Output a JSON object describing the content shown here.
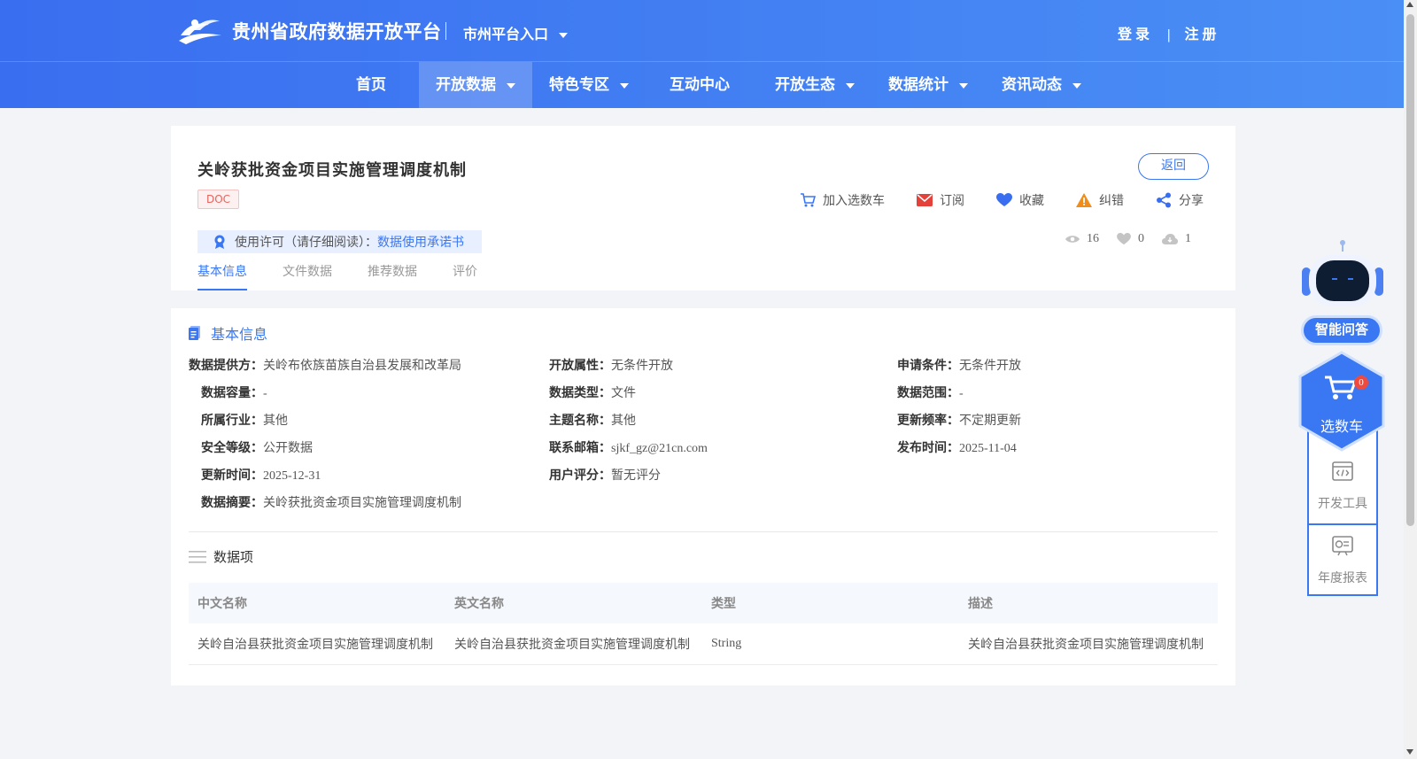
{
  "header": {
    "site_title": "贵州省政府数据开放平台",
    "city_entry": "市州平台入口",
    "login": "登录",
    "auth_sep": "|",
    "register": "注册"
  },
  "nav": {
    "items": [
      {
        "label": "首页",
        "has_dropdown": false,
        "active": false
      },
      {
        "label": "开放数据",
        "has_dropdown": true,
        "active": true
      },
      {
        "label": "特色专区",
        "has_dropdown": true,
        "active": false
      },
      {
        "label": "互动中心",
        "has_dropdown": false,
        "active": false
      },
      {
        "label": "开放生态",
        "has_dropdown": true,
        "active": false
      },
      {
        "label": "数据统计",
        "has_dropdown": true,
        "active": false
      },
      {
        "label": "资讯动态",
        "has_dropdown": true,
        "active": false
      }
    ]
  },
  "dataset": {
    "title": "关岭获批资金项目实施管理调度机制",
    "format_tag": "DOC",
    "back_label": "返回",
    "actions": {
      "cart": "加入选数车",
      "subscribe": "订阅",
      "favorite": "收藏",
      "report": "纠错",
      "share": "分享"
    },
    "license_label": "使用许可（请仔细阅读）：",
    "license_link": "数据使用承诺书",
    "stats": {
      "views": "16",
      "likes": "0",
      "downloads": "1"
    },
    "tabs": [
      "基本信息",
      "文件数据",
      "推荐数据",
      "评价"
    ]
  },
  "basic_info": {
    "section_title": "基本信息",
    "fields": {
      "provider": {
        "label": "数据提供方：",
        "value": "关岭布依族苗族自治县发展和改革局"
      },
      "open_attr": {
        "label": "开放属性：",
        "value": "无条件开放"
      },
      "apply_cond": {
        "label": "申请条件：",
        "value": "无条件开放"
      },
      "capacity": {
        "label": "数据容量：",
        "value": "-"
      },
      "data_type": {
        "label": "数据类型：",
        "value": "文件"
      },
      "data_scope": {
        "label": "数据范围：",
        "value": "-"
      },
      "industry": {
        "label": "所属行业：",
        "value": "其他"
      },
      "topic": {
        "label": "主题名称：",
        "value": "其他"
      },
      "frequency": {
        "label": "更新频率：",
        "value": "不定期更新"
      },
      "security": {
        "label": "安全等级：",
        "value": "公开数据"
      },
      "email": {
        "label": "联系邮箱：",
        "value": "sjkf_gz@21cn.com"
      },
      "publish_time": {
        "label": "发布时间：",
        "value": "2025-11-04"
      },
      "update_time": {
        "label": "更新时间：",
        "value": "2025-12-31"
      },
      "rating": {
        "label": "用户评分：",
        "value": "暂无评分"
      },
      "summary": {
        "label": "数据摘要：",
        "value": "关岭获批资金项目实施管理调度机制"
      }
    }
  },
  "data_items": {
    "title": "数据项",
    "columns": [
      "中文名称",
      "英文名称",
      "类型",
      "描述"
    ],
    "rows": [
      [
        "关岭自治县获批资金项目实施管理调度机制",
        "关岭自治县获批资金项目实施管理调度机制",
        "String",
        "关岭自治县获批资金项目实施管理调度机制"
      ]
    ]
  },
  "side": {
    "ai_label": "智能问答",
    "cart_label": "选数车",
    "cart_count": "0",
    "dev_tools": "开发工具",
    "annual_report": "年度报表"
  },
  "colors": {
    "primary": "#3a77f2",
    "header_start": "#3a6ef0",
    "header_end": "#4a8ff5",
    "tag_red": "#e5645e"
  }
}
